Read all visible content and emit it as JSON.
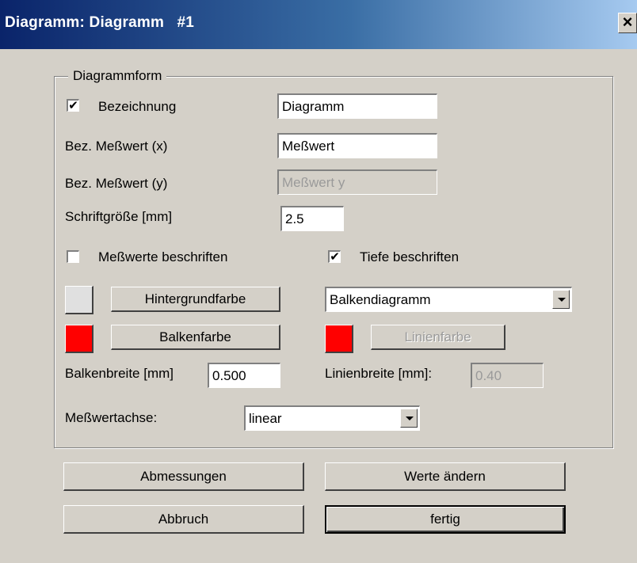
{
  "window": {
    "title": "Diagramm: Diagramm   #1",
    "close_glyph": "×"
  },
  "group": {
    "legend": "Diagrammform"
  },
  "bezeichnung": {
    "label": "Bezeichnung",
    "checked": true,
    "value": "Diagramm"
  },
  "bez_x": {
    "label": "Bez. Meßwert (x)",
    "value": "Meßwert"
  },
  "bez_y": {
    "label": "Bez. Meßwert (y)",
    "value": "Meßwert y"
  },
  "schrift": {
    "label": "Schriftgröße [mm]",
    "value": "2.5"
  },
  "messwerte_beschriften": {
    "label": "Meßwerte beschriften",
    "checked": false
  },
  "tiefe_beschriften": {
    "label": "Tiefe beschriften",
    "checked": true
  },
  "hintergrund": {
    "button": "Hintergrundfarbe",
    "color": "#e0e0e0"
  },
  "diagrammtyp": {
    "selected": "Balkendiagramm"
  },
  "balken": {
    "button": "Balkenfarbe",
    "color": "#ff0000"
  },
  "linien": {
    "button": "Linienfarbe",
    "color": "#ff0000"
  },
  "balkenbreite": {
    "label": "Balkenbreite [mm]",
    "value": "0.500"
  },
  "linienbreite": {
    "label": "Linienbreite [mm]:",
    "value": "0.40"
  },
  "achse": {
    "label": "Meßwertachse:",
    "selected": "linear"
  },
  "buttons": {
    "abmessungen": "Abmessungen",
    "werte": "Werte ändern",
    "abbruch": "Abbruch",
    "fertig": "fertig"
  },
  "check_glyph": "✔"
}
